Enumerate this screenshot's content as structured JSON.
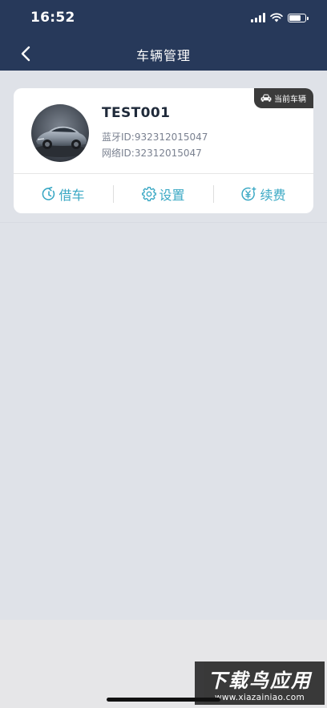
{
  "status_bar": {
    "time": "16:52",
    "icons": [
      "cellular-signal-icon",
      "wifi-icon",
      "battery-icon"
    ],
    "battery_level": 0.85
  },
  "nav": {
    "back_icon": "chevron-left-icon",
    "title": "车辆管理"
  },
  "vehicle": {
    "badge": {
      "icon": "car-icon",
      "label": "当前车辆"
    },
    "name": "TEST001",
    "bluetooth_id": "蓝牙ID:932312015047",
    "network_id": "网络ID:32312015047"
  },
  "actions": [
    {
      "icon": "borrow-car-icon",
      "label": "借车"
    },
    {
      "icon": "settings-gear-icon",
      "label": "设置"
    },
    {
      "icon": "renew-fee-icon",
      "label": "续费"
    }
  ],
  "watermark": {
    "main": "下载鸟应用",
    "sub": "www.xiazainiao.com"
  },
  "colors": {
    "header_bg": "#27395a",
    "page_bg": "#dfe2e8",
    "accent": "#3aa8c4",
    "badge_bg": "#3b3b3b"
  }
}
